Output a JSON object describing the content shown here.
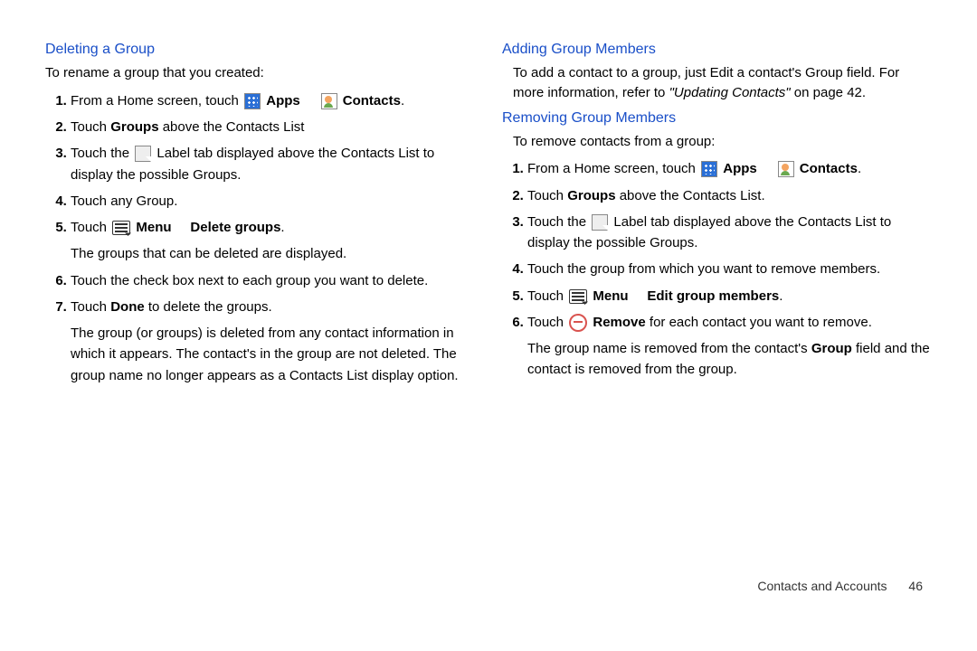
{
  "left": {
    "heading": "Deleting a Group",
    "intro": "To rename a group that you created:",
    "step1_a": "From a Home screen, touch ",
    "step1_apps": "Apps",
    "step1_b": " ",
    "step1_contacts": "Contacts",
    "step1_c": ".",
    "step2_a": "Touch ",
    "step2_b": "Groups",
    "step2_c": " above the Contacts List",
    "step3_a": "Touch the ",
    "step3_b": " Label tab displayed above the Contacts List to display the possible Groups.",
    "step4": "Touch any Group.",
    "step5_a": "Touch ",
    "step5_menu": "Menu",
    "step5_arrow": " ",
    "step5_delete": "Delete groups",
    "step5_dot": ".",
    "step5_sub": "The groups that can be deleted are displayed.",
    "step6": "Touch the check box next to each group you want to delete.",
    "step7_a": "Touch ",
    "step7_b": "Done",
    "step7_c": " to delete the groups.",
    "step7_sub": "The group (or groups) is deleted from any contact information in which it appears. The contact's in the group are not deleted. The group name no longer appears as a Contacts List display option."
  },
  "right": {
    "heading1": "Adding Group Members",
    "para1_a": "To add a contact to a group, just Edit a contact's Group field. For more information, refer to ",
    "para1_ref": "\"Updating Contacts\"",
    "para1_b": " on page 42.",
    "heading2": "Removing Group Members",
    "intro2": "To remove contacts from a group:",
    "step1_a": "From a Home screen, touch ",
    "step1_apps": "Apps",
    "step1_contacts": "Contacts",
    "step1_c": ".",
    "step2_a": "Touch ",
    "step2_b": "Groups",
    "step2_c": " above the Contacts List.",
    "step3_a": "Touch the ",
    "step3_b": " Label tab displayed above the Contacts List to display the possible Groups.",
    "step4": "Touch the group from which you want to remove members.",
    "step5_a": "Touch ",
    "step5_menu": "Menu",
    "step5_edit": "Edit group members",
    "step5_dot": ".",
    "step6_a": "Touch ",
    "step6_remove": "Remove",
    "step6_b": " for each contact you want to remove.",
    "step6_sub_a": "The group name is removed from the contact's ",
    "step6_sub_b": "Group",
    "step6_sub_c": " field and the contact is removed from the group."
  },
  "footer": {
    "section": "Contacts and Accounts",
    "page": "46"
  }
}
